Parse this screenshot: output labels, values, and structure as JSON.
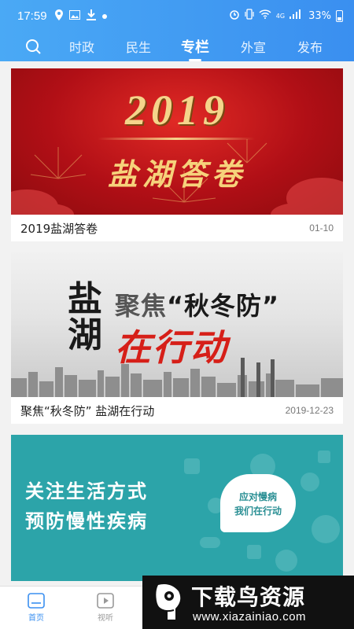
{
  "status_bar": {
    "time": "17:59",
    "battery": "33%",
    "network": "4G"
  },
  "nav": {
    "search_icon": "search-icon",
    "tabs": [
      {
        "label": "时政",
        "active": false
      },
      {
        "label": "民生",
        "active": false
      },
      {
        "label": "专栏",
        "active": true
      },
      {
        "label": "外宣",
        "active": false
      },
      {
        "label": "发布",
        "active": false
      }
    ]
  },
  "cards": [
    {
      "banner": {
        "year": "2019",
        "subtitle": "盐湖答卷"
      },
      "title": "2019盐湖答卷",
      "date": "01-10"
    },
    {
      "banner": {
        "yan": "盐",
        "hu": "湖",
        "focus_prefix": "聚焦",
        "focus_quote": "“秋冬防”",
        "action": "在行动"
      },
      "title": "聚焦“秋冬防” 盐湖在行动",
      "date": "2019-12-23"
    },
    {
      "banner": {
        "line1": "关注生活方式",
        "line2": "预防慢性疾病",
        "bubble_line1": "应对慢病",
        "bubble_line2": "我们在行动"
      },
      "title": "",
      "date": ""
    }
  ],
  "bottom_nav": [
    {
      "label": "首页",
      "icon": "home-icon",
      "active": true
    },
    {
      "label": "视听",
      "icon": "video-icon",
      "active": false
    }
  ],
  "watermark": {
    "brand": "下载鸟资源",
    "url": "www.xiazainiao.com"
  },
  "colors": {
    "header": "#3a8ff0",
    "accent": "#3a8ff0",
    "banner_red": "#b10f16",
    "banner_teal": "#2ca4a9"
  }
}
